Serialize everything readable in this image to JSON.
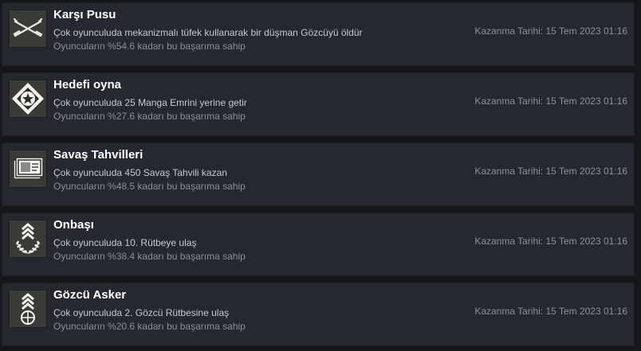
{
  "achievements": [
    {
      "icon": "crossed-rifles-icon",
      "title": "Karşı Pusu",
      "description": "Çok oyunculuda mekanizmalı tüfek kullanarak bir düşman Gözcüyü öldür",
      "percent": "Oyuncuların %54.6 kadarı bu başarıma sahip",
      "date": "Kazanma Tarihi: 15 Tem 2023 01:16"
    },
    {
      "icon": "objective-star-diamond-icon",
      "title": "Hedefi oyna",
      "description": "Çok oyunculuda 25 Manga Emrini yerine getir",
      "percent": "Oyuncuların %27.6 kadarı bu başarıma sahip",
      "date": "Kazanma Tarihi: 15 Tem 2023 01:16"
    },
    {
      "icon": "war-bonds-icon",
      "title": "Savaş Tahvilleri",
      "description": "Çok oyunculuda 450 Savaş Tahvili kazan",
      "percent": "Oyuncuların %48.5 kadarı bu başarıma sahip",
      "date": "Kazanma Tarihi: 15 Tem 2023 01:16"
    },
    {
      "icon": "corporal-rank-icon",
      "title": "Onbaşı",
      "description": "Çok oyunculuda 10. Rütbeye ulaş",
      "percent": "Oyuncuların %38.4 kadarı bu başarıma sahip",
      "date": "Kazanma Tarihi: 15 Tem 2023 01:16"
    },
    {
      "icon": "scout-rank-crosshair-icon",
      "title": "Gözcü Asker",
      "description": "Çok oyunculuda 2. Gözcü Rütbesine ulaş",
      "percent": "Oyuncuların %20.6 kadarı bu başarıma sahip",
      "date": "Kazanma Tarihi: 15 Tem 2023 01:16"
    }
  ]
}
